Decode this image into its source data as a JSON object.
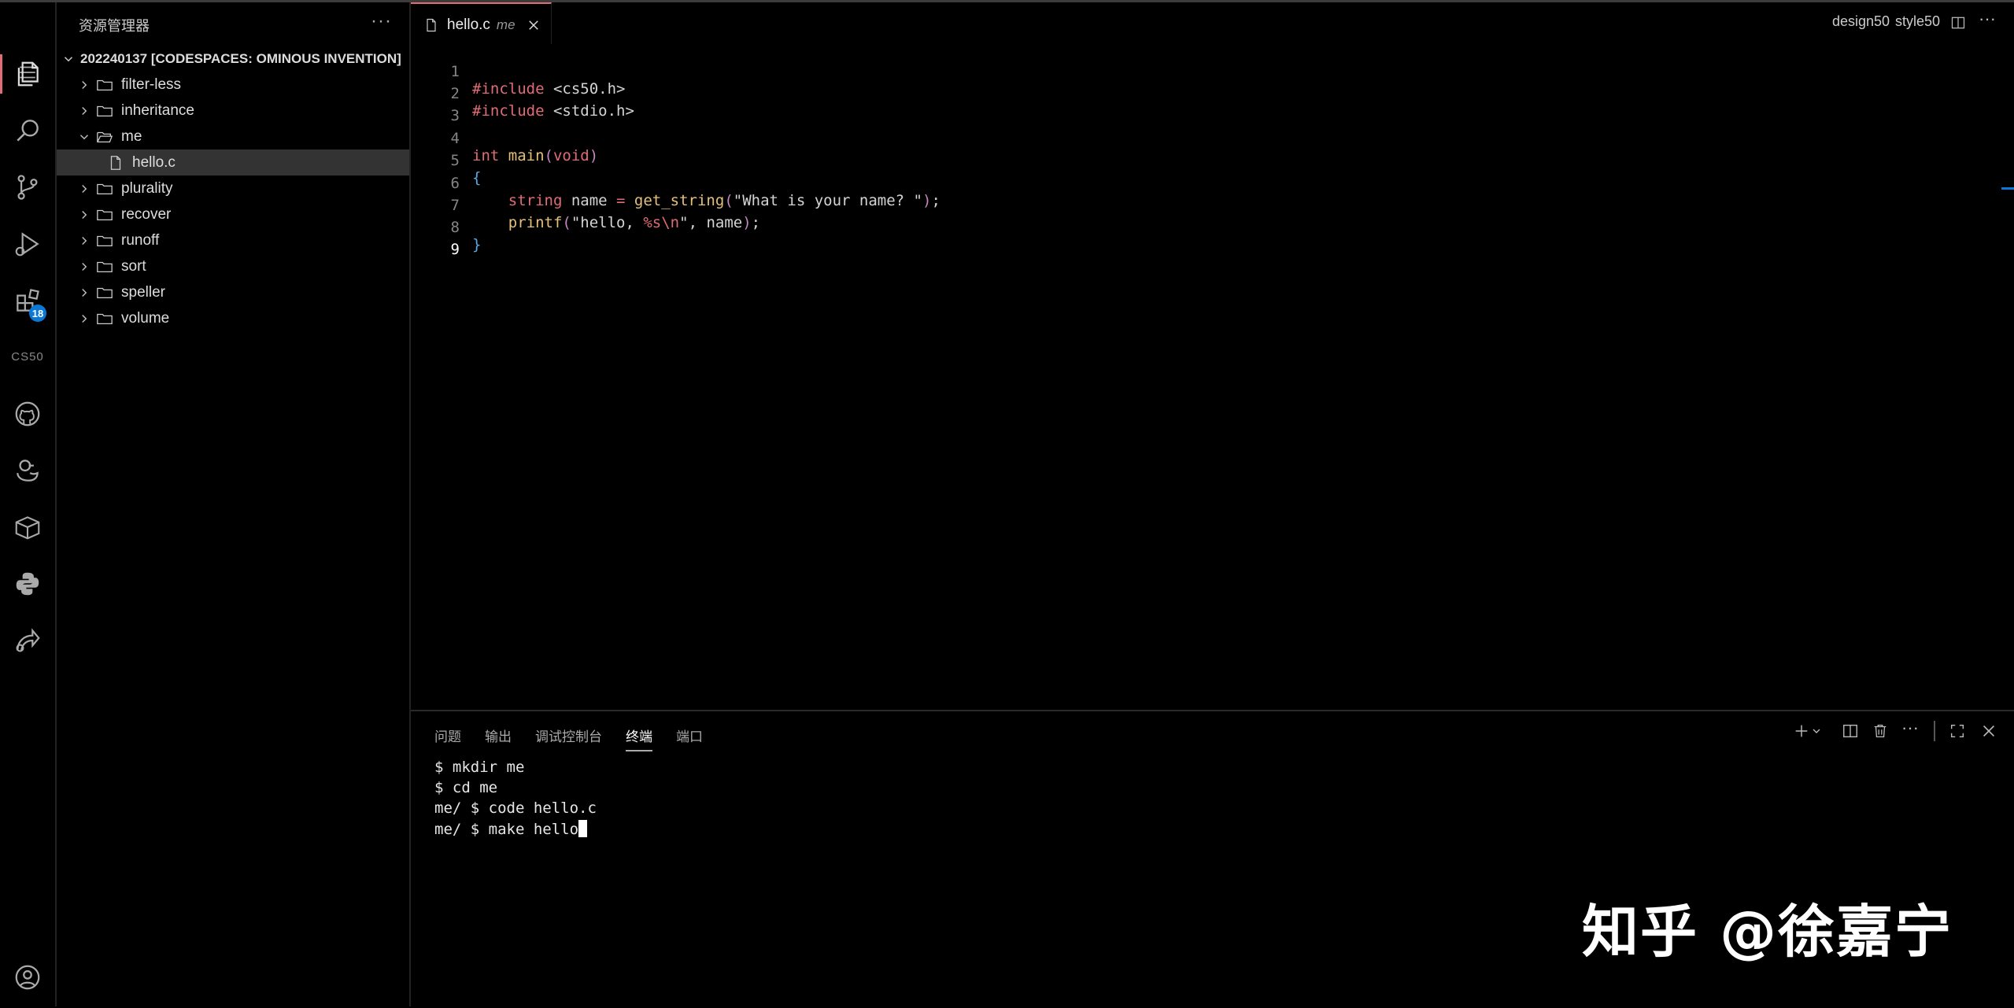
{
  "sidebar": {
    "title": "资源管理器",
    "more": "···",
    "root": "202240137 [CODESPACES: OMINOUS INVENTION]",
    "items": [
      {
        "label": "filter-less",
        "kind": "folder",
        "open": false
      },
      {
        "label": "inheritance",
        "kind": "folder",
        "open": false
      },
      {
        "label": "me",
        "kind": "folder",
        "open": true
      },
      {
        "label": "hello.c",
        "kind": "file",
        "selected": true
      },
      {
        "label": "plurality",
        "kind": "folder",
        "open": false
      },
      {
        "label": "recover",
        "kind": "folder",
        "open": false
      },
      {
        "label": "runoff",
        "kind": "folder",
        "open": false
      },
      {
        "label": "sort",
        "kind": "folder",
        "open": false
      },
      {
        "label": "speller",
        "kind": "folder",
        "open": false
      },
      {
        "label": "volume",
        "kind": "folder",
        "open": false
      }
    ]
  },
  "activity": {
    "extensions_badge": "18",
    "cs50_label": "CS50"
  },
  "editor": {
    "tab": {
      "name": "hello.c",
      "dir": "me"
    },
    "right": {
      "design": "design50",
      "style": "style50"
    },
    "line_numbers": [
      "1",
      "2",
      "3",
      "4",
      "5",
      "6",
      "7",
      "8",
      "9"
    ],
    "code": {
      "l1": {
        "a": "#include",
        "b": " <cs50.h>"
      },
      "l2": {
        "a": "#include",
        "b": " <stdio.h>"
      },
      "l4": {
        "a": "int",
        "b": " main",
        "c": "(",
        "d": "void",
        "e": ")"
      },
      "l5": "{",
      "l6": {
        "a": "    string",
        "b": " name ",
        "c": "=",
        "d": " get_string",
        "e": "(",
        "f": "\"What is your name? \"",
        "g": ")",
        "h": ";"
      },
      "l7": {
        "a": "    printf",
        "b": "(",
        "c": "\"hello, ",
        "d": "%s\\n",
        "e": "\"",
        "f": ", name",
        "g": ")",
        "h": ";"
      },
      "l8": "}"
    }
  },
  "panel": {
    "tabs": [
      "问题",
      "输出",
      "调试控制台",
      "终端",
      "端口"
    ],
    "active_tab": "终端",
    "terminal": [
      "$ mkdir me",
      "$ cd me",
      "me/ $ code hello.c",
      "me/ $ make hello"
    ]
  },
  "watermark": "知乎 @徐嘉宁",
  "colors": {
    "accent": "#e06c75",
    "badge": "#0a78d7"
  }
}
